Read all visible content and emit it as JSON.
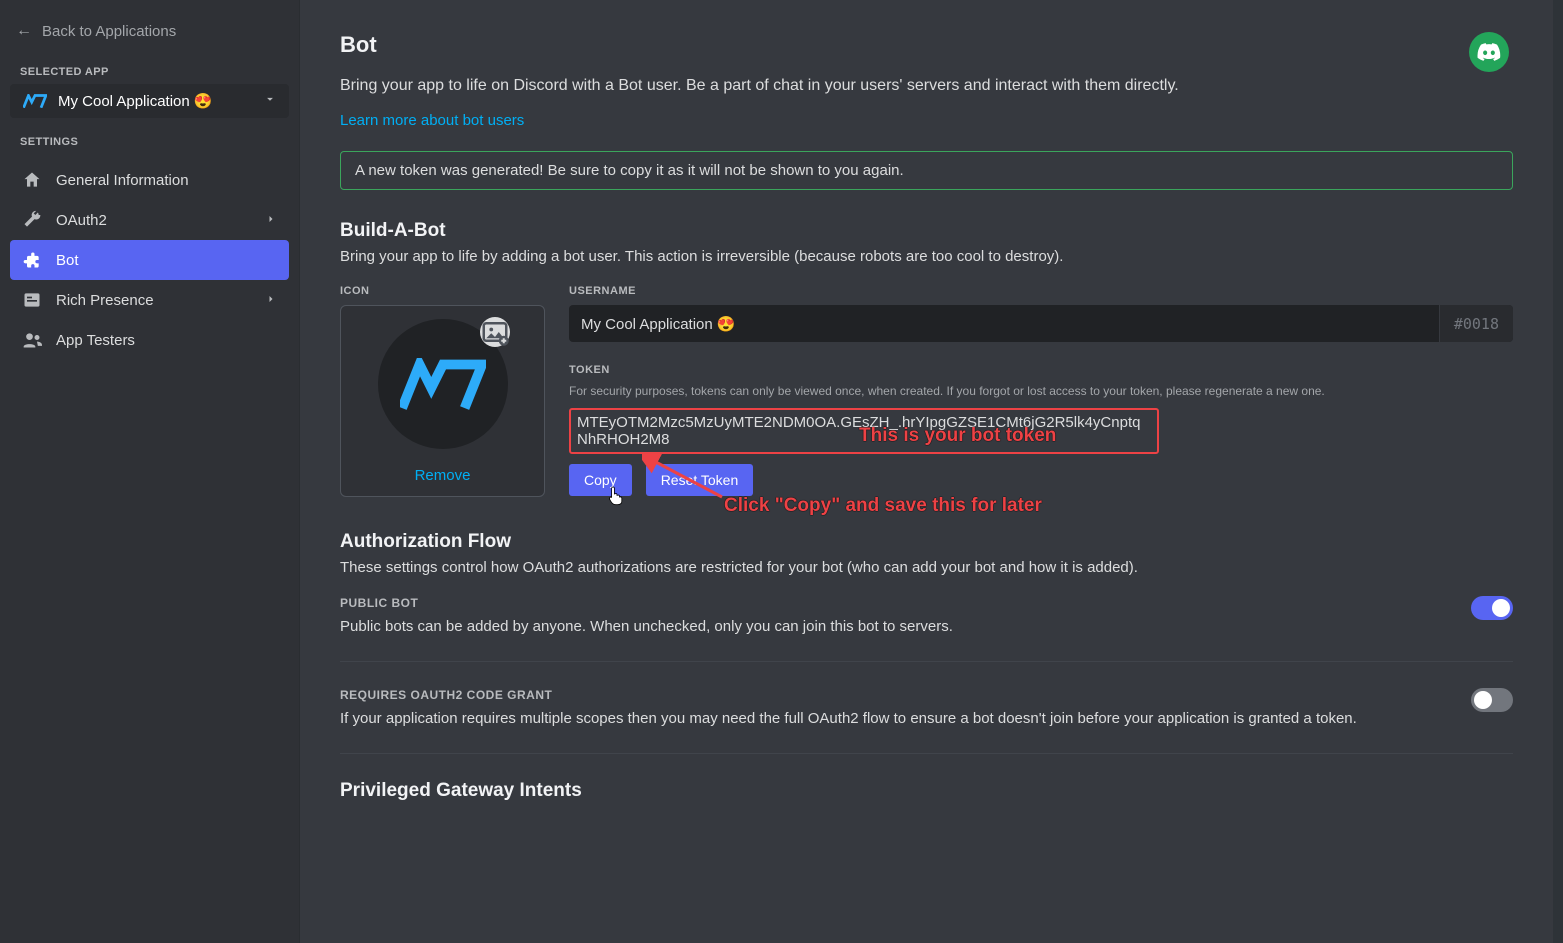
{
  "sidebar": {
    "back_label": "Back to Applications",
    "selected_app_heading": "SELECTED APP",
    "selected_app_name": "My Cool Application 😍",
    "settings_heading": "SETTINGS",
    "items": [
      {
        "id": "general",
        "label": "General Information"
      },
      {
        "id": "oauth2",
        "label": "OAuth2"
      },
      {
        "id": "bot",
        "label": "Bot"
      },
      {
        "id": "rich-presence",
        "label": "Rich Presence"
      },
      {
        "id": "app-testers",
        "label": "App Testers"
      }
    ]
  },
  "page": {
    "title": "Bot",
    "subtitle": "Bring your app to life on Discord with a Bot user. Be a part of chat in your users' servers and interact with them directly.",
    "learn_more": "Learn more about bot users",
    "alert": "A new token was generated! Be sure to copy it as it will not be shown to you again."
  },
  "build": {
    "title": "Build-A-Bot",
    "subtitle": "Bring your app to life by adding a bot user. This action is irreversible (because robots are too cool to destroy).",
    "icon_label": "ICON",
    "remove": "Remove",
    "username_label": "USERNAME",
    "username_value": "My Cool Application 😍",
    "discriminator": "#0018",
    "token_label": "TOKEN",
    "token_hint": "For security purposes, tokens can only be viewed once, when created. If you forgot or lost access to your token, please regenerate a new one.",
    "token_value": "MTEyOTM2Mzc5MzUyMTE2NDM0OA.GEsZH_.hrYIpgGZSE1CMt6jG2R5lk4yCnptqNhRHOH2M8",
    "copy_btn": "Copy",
    "reset_btn": "Reset Token"
  },
  "auth": {
    "title": "Authorization Flow",
    "subtitle": "These settings control how OAuth2 authorizations are restricted for your bot (who can add your bot and how it is added).",
    "public_title": "PUBLIC BOT",
    "public_desc": "Public bots can be added by anyone. When unchecked, only you can join this bot to servers.",
    "grant_title": "REQUIRES OAUTH2 CODE GRANT",
    "grant_desc": "If your application requires multiple scopes then you may need the full OAuth2 flow to ensure a bot doesn't join before your application is granted a token."
  },
  "intents": {
    "title": "Privileged Gateway Intents"
  },
  "annotations": {
    "token_note": "This is your bot token",
    "copy_note": "Click \"Copy\" and save this for later"
  },
  "colors": {
    "blurple": "#5865f2",
    "green": "#23a55a",
    "link": "#00aff4",
    "annotation": "#ed4245"
  }
}
